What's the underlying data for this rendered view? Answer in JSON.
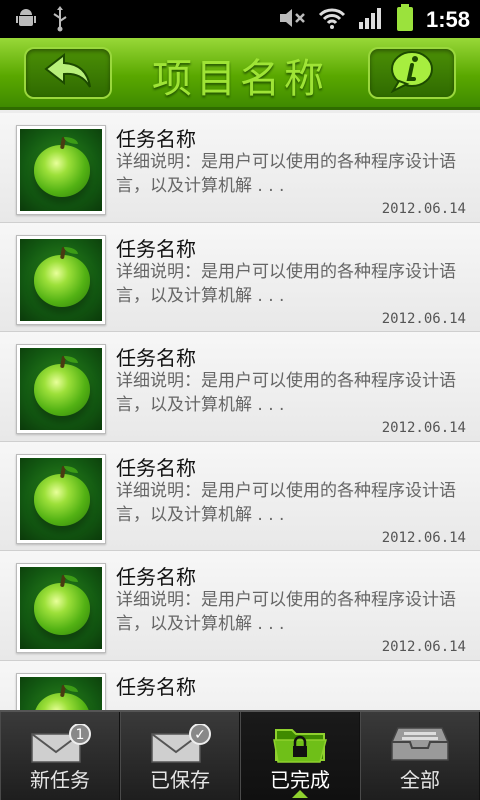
{
  "status_bar": {
    "time": "1:58"
  },
  "header": {
    "title": "项目名称"
  },
  "items": [
    {
      "title": "任务名称",
      "description": "详细说明：是用户可以使用的各种程序设计语言，以及计算机解 . . .",
      "date": "2012.06.14"
    },
    {
      "title": "任务名称",
      "description": "详细说明：是用户可以使用的各种程序设计语言，以及计算机解 . . .",
      "date": "2012.06.14"
    },
    {
      "title": "任务名称",
      "description": "详细说明：是用户可以使用的各种程序设计语言，以及计算机解 . . .",
      "date": "2012.06.14"
    },
    {
      "title": "任务名称",
      "description": "详细说明：是用户可以使用的各种程序设计语言，以及计算机解 . . .",
      "date": "2012.06.14"
    },
    {
      "title": "任务名称",
      "description": "详细说明：是用户可以使用的各种程序设计语言，以及计算机解 . . .",
      "date": "2012.06.14"
    },
    {
      "title": "任务名称",
      "description": "",
      "date": ""
    }
  ],
  "tabs": [
    {
      "label": "新任务",
      "icon": "mail-icon",
      "badge": "1"
    },
    {
      "label": "已保存",
      "icon": "mail-saved-icon",
      "badge": "✓"
    },
    {
      "label": "已完成",
      "icon": "lock-folder-icon",
      "active": true
    },
    {
      "label": "全部",
      "icon": "inbox-tray-icon"
    }
  ],
  "colors": {
    "accent": "#5aa800",
    "header_title": "#9fe436"
  }
}
